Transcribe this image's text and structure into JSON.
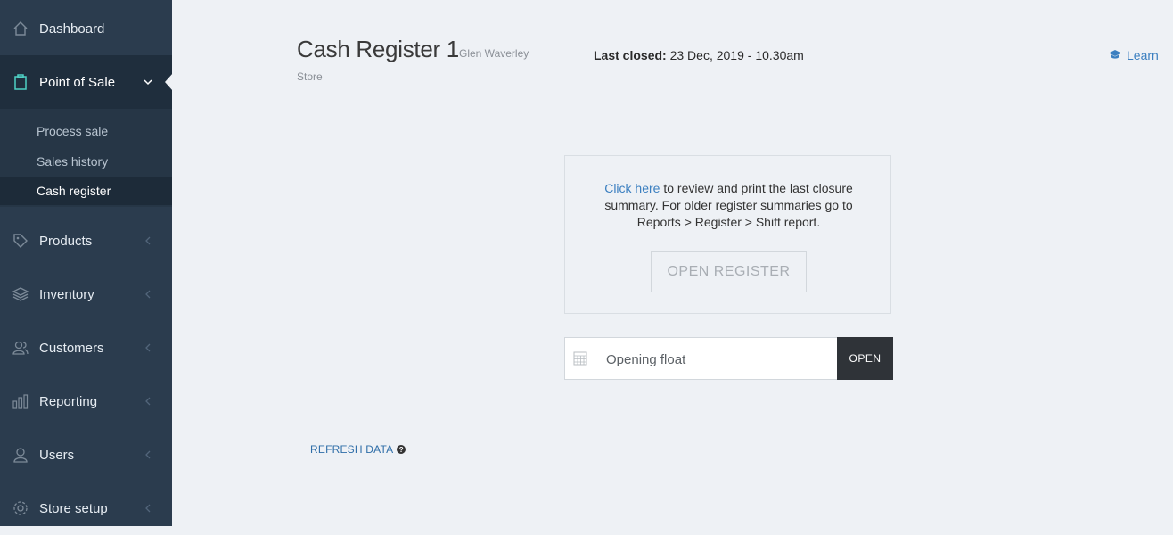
{
  "sidebar": {
    "dashboard": "Dashboard",
    "point_of_sale": "Point of Sale",
    "submenu": {
      "process_sale": "Process sale",
      "sales_history": "Sales history",
      "cash_register": "Cash register"
    },
    "products": "Products",
    "inventory": "Inventory",
    "customers": "Customers",
    "reporting": "Reporting",
    "users": "Users",
    "store_setup": "Store setup"
  },
  "header": {
    "title": "Cash Register 1",
    "store_line1": "Glen Waverley",
    "store_line2": "Store",
    "last_closed_label": "Last closed:",
    "last_closed_value": "23 Dec, 2019 - 10.30am",
    "learn": "Learn"
  },
  "panel": {
    "link": "Click here",
    "text": "to review and print the last closure summary. For older register summaries go to Reports > Register > Shift report.",
    "open_register": "OPEN REGISTER"
  },
  "float": {
    "placeholder": "Opening float",
    "open": "OPEN"
  },
  "footer": {
    "refresh": "REFRESH DATA"
  },
  "colors": {
    "sidebar_bg": "#2b3c4e",
    "accent_teal": "#4fd1c5",
    "link_blue": "#3b7fc0"
  }
}
